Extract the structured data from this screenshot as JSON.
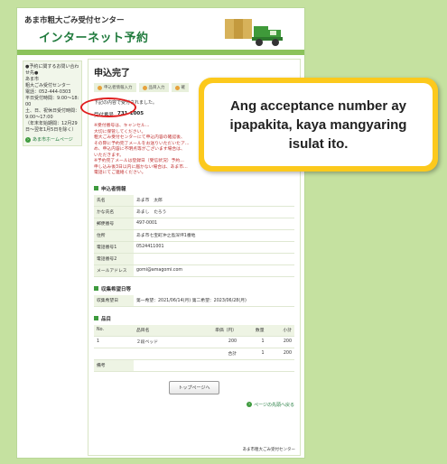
{
  "header": {
    "title": "あま市粗大ごみ受付センター",
    "brand": "インターネット予約"
  },
  "sidebar": {
    "contact": "●予約に関するお問い合わせ先●\nあま市\n粗大ごみ受付センター\n電話：052-444-0303\n平日受付時間：9:00～18:00\n土、日、祝休日受付時間：9:00～17:00\n（年末年始期間：12月29日～翌年1月5日を除く）",
    "home_link": "あま市ホームページ"
  },
  "main": {
    "title": "申込完了",
    "steps": [
      "申込者情報入力",
      "品目入力",
      "確"
    ],
    "intro": "下記の内容で受付されました。",
    "accept_label": "受付番号",
    "accept_number": "731-1005",
    "notes": "※受付番号は、キャンセル…\n大切に保管してください。\n粗大ごみ受付センターにて申込内容の確認後、\nその際に予約完了メールをお送りいただいたア…\nめ、申込内容に不明点等がございます場合は、\nいただきます。\n※予約完了メールは登録日（受信状況）予約…\n申し込み後3日以内に届かない場合は、あま市…\n電話にてご連絡ください。",
    "applicant_title": "申込者情報",
    "applicant": [
      {
        "k": "氏名",
        "v": "あま市　太郎"
      },
      {
        "k": "かな氏名",
        "v": "あまし　たろう"
      },
      {
        "k": "郵便番号",
        "v": "497-0001"
      },
      {
        "k": "住所",
        "v": "あま市七宝町沖之島深坪1番地"
      },
      {
        "k": "電話番号1",
        "v": "0524411001"
      },
      {
        "k": "電話番号2",
        "v": ""
      },
      {
        "k": "メールアドレス",
        "v": "gomi@amagomi.com"
      }
    ],
    "collection_title": "収集希望日等",
    "collection": {
      "k": "収集希望日",
      "v": "第一希望：2021/06/14(月)  第二希望：2023/06/28(月)"
    },
    "items_title": "品目",
    "items_head": {
      "no": "No.",
      "name": "品目名",
      "price": "単価（円）",
      "qty": "数量",
      "subtotal": "小計"
    },
    "items": [
      {
        "no": "1",
        "name": "２段ベッド",
        "price": "200",
        "qty": "1",
        "subtotal": "200"
      }
    ],
    "total": {
      "label": "合計",
      "qty": "1",
      "subtotal": "200"
    },
    "remarks_label": "備考",
    "top_button": "トップページへ",
    "page_top": "ページの先頭へ戻る",
    "footer": "あま市粗大ごみ受付センター"
  },
  "callout": {
    "text": "Ang acceptance number ay ipapakita, kaya mangyaring isulat ito."
  }
}
